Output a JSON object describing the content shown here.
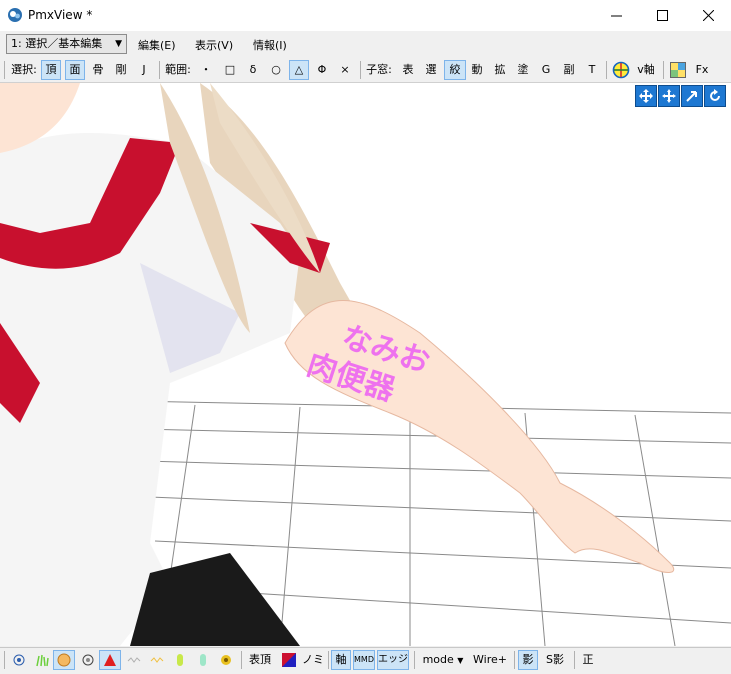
{
  "window": {
    "title": "PmxView *"
  },
  "menubar": {
    "mode_select": "1: 選択／基本編集",
    "items": [
      "編集(E)",
      "表示(V)",
      "情報(I)"
    ]
  },
  "toolbar": {
    "select_label": "選択:",
    "select_items": [
      "頂",
      "面",
      "骨",
      "剛",
      "J"
    ],
    "range_label": "範囲:",
    "range_items": [
      "・",
      "□",
      "δ",
      "○",
      "△",
      "Φ",
      "×"
    ],
    "child_label": "子窓:",
    "child_items": [
      "表",
      "選",
      "絞",
      "動",
      "拡",
      "塗",
      "G",
      "副",
      "T"
    ],
    "vaxis_label": "v軸",
    "fx_label": "Fx"
  },
  "bottombar": {
    "vertex_label": "表頂",
    "mi_label": "ノミ",
    "axis_label": "軸",
    "mmd_label": "MMD",
    "edge_label": "エッジ",
    "mode_label": "mode",
    "wire_label": "Wire+",
    "shadow_label": "影",
    "sshadow_label": "S影",
    "front_label": "正"
  },
  "viewport": {
    "arm_text": [
      "なみお",
      "肉便器"
    ]
  },
  "colors": {
    "accent_blue": "#1e78d2",
    "toggle_bg": "#cce4f7",
    "skin": "#fde4d4",
    "shirt": "#f5f5f5",
    "trim_red": "#c8102e",
    "hair": "#e8d5bd",
    "arm_text": "#ee72ee"
  }
}
